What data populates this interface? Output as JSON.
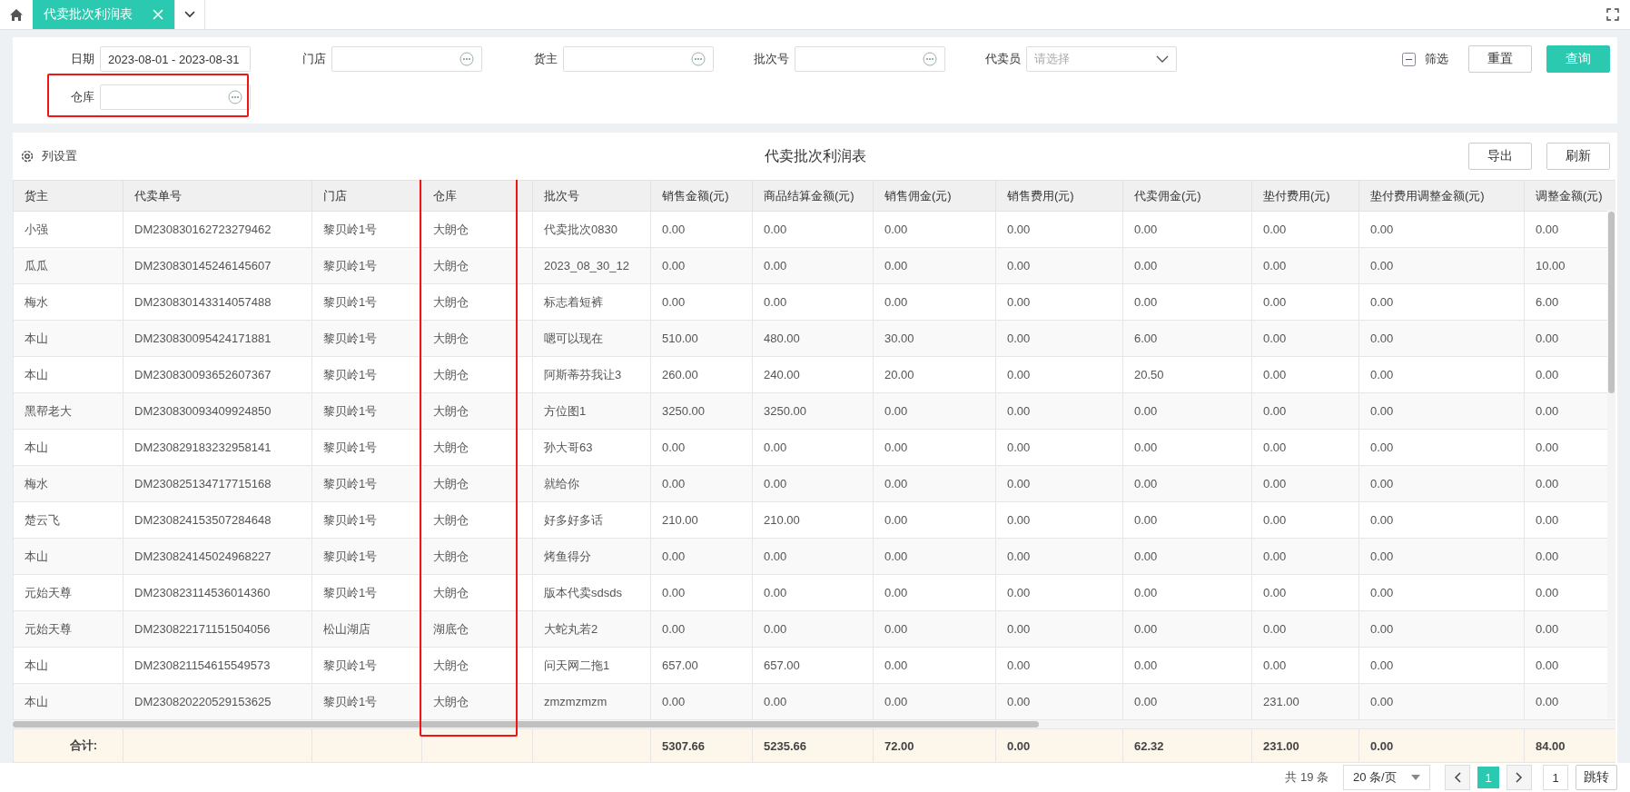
{
  "tabs": [
    {
      "label": "代卖批次利润表",
      "selected": true
    }
  ],
  "filters": [
    {
      "label": "日期",
      "kind": "text",
      "value": "2023-08-01 - 2023-08-31",
      "highlighted": false
    },
    {
      "label": "门店",
      "kind": "picker",
      "highlighted": false
    },
    {
      "label": "货主",
      "kind": "picker",
      "highlighted": false
    },
    {
      "label": "批次号",
      "kind": "picker",
      "highlighted": false
    },
    {
      "label": "代卖员",
      "kind": "select",
      "placeholder": "请选择",
      "highlighted": false
    },
    {
      "label": "仓库",
      "kind": "picker",
      "highlighted": true
    }
  ],
  "filter_toggle": {
    "label": "筛选"
  },
  "filter_buttons": [
    {
      "label": "重置",
      "kind": "secondary"
    },
    {
      "label": "查询",
      "kind": "primary"
    }
  ],
  "table_toolbar": {
    "settings_label": "列设置",
    "title": "代卖批次利润表",
    "buttons": [
      "导出",
      "刷新"
    ]
  },
  "table": {
    "columns": [
      {
        "label": "货主",
        "highlighted": false
      },
      {
        "label": "代卖单号",
        "highlighted": false
      },
      {
        "label": "门店",
        "highlighted": false
      },
      {
        "label": "仓库",
        "highlighted": true
      },
      {
        "label": "批次号",
        "highlighted": false
      },
      {
        "label": "销售金额(元)",
        "highlighted": false
      },
      {
        "label": "商品结算金额(元)",
        "highlighted": false
      },
      {
        "label": "销售佣金(元)",
        "highlighted": false
      },
      {
        "label": "销售费用(元)",
        "highlighted": false
      },
      {
        "label": "代卖佣金(元)",
        "highlighted": false
      },
      {
        "label": "垫付费用(元)",
        "highlighted": false
      },
      {
        "label": "垫付费用调整金额(元)",
        "highlighted": false
      },
      {
        "label": "调整金额(元)",
        "highlighted": false
      }
    ],
    "rows": [
      [
        "小强",
        "DM230830162723279462",
        "黎贝岭1号",
        "大朗仓",
        "代卖批次0830",
        "0.00",
        "0.00",
        "0.00",
        "0.00",
        "0.00",
        "0.00",
        "0.00",
        "0.00"
      ],
      [
        "瓜瓜",
        "DM230830145246145607",
        "黎贝岭1号",
        "大朗仓",
        "2023_08_30_12",
        "0.00",
        "0.00",
        "0.00",
        "0.00",
        "0.00",
        "0.00",
        "0.00",
        "10.00"
      ],
      [
        "梅水",
        "DM230830143314057488",
        "黎贝岭1号",
        "大朗仓",
        "标志着短裤",
        "0.00",
        "0.00",
        "0.00",
        "0.00",
        "0.00",
        "0.00",
        "0.00",
        "6.00"
      ],
      [
        "本山",
        "DM230830095424171881",
        "黎贝岭1号",
        "大朗仓",
        "嗯可以现在",
        "510.00",
        "480.00",
        "30.00",
        "0.00",
        "6.00",
        "0.00",
        "0.00",
        "0.00"
      ],
      [
        "本山",
        "DM230830093652607367",
        "黎贝岭1号",
        "大朗仓",
        "阿斯蒂芬我让3",
        "260.00",
        "240.00",
        "20.00",
        "0.00",
        "20.50",
        "0.00",
        "0.00",
        "0.00"
      ],
      [
        "黑帮老大",
        "DM230830093409924850",
        "黎贝岭1号",
        "大朗仓",
        "方位图1",
        "3250.00",
        "3250.00",
        "0.00",
        "0.00",
        "0.00",
        "0.00",
        "0.00",
        "0.00"
      ],
      [
        "本山",
        "DM230829183232958141",
        "黎贝岭1号",
        "大朗仓",
        "孙大哥63",
        "0.00",
        "0.00",
        "0.00",
        "0.00",
        "0.00",
        "0.00",
        "0.00",
        "0.00"
      ],
      [
        "梅水",
        "DM230825134717715168",
        "黎贝岭1号",
        "大朗仓",
        "就给你",
        "0.00",
        "0.00",
        "0.00",
        "0.00",
        "0.00",
        "0.00",
        "0.00",
        "0.00"
      ],
      [
        "楚云飞",
        "DM230824153507284648",
        "黎贝岭1号",
        "大朗仓",
        "好多好多话",
        "210.00",
        "210.00",
        "0.00",
        "0.00",
        "0.00",
        "0.00",
        "0.00",
        "0.00"
      ],
      [
        "本山",
        "DM230824145024968227",
        "黎贝岭1号",
        "大朗仓",
        "烤鱼得分",
        "0.00",
        "0.00",
        "0.00",
        "0.00",
        "0.00",
        "0.00",
        "0.00",
        "0.00"
      ],
      [
        "元始天尊",
        "DM230823114536014360",
        "黎贝岭1号",
        "大朗仓",
        "版本代卖sdsds",
        "0.00",
        "0.00",
        "0.00",
        "0.00",
        "0.00",
        "0.00",
        "0.00",
        "0.00"
      ],
      [
        "元始天尊",
        "DM230822171151504056",
        "松山湖店",
        "湖底仓",
        "大蛇丸若2",
        "0.00",
        "0.00",
        "0.00",
        "0.00",
        "0.00",
        "0.00",
        "0.00",
        "0.00"
      ],
      [
        "本山",
        "DM230821154615549573",
        "黎贝岭1号",
        "大朗仓",
        "问天网二拖1",
        "657.00",
        "657.00",
        "0.00",
        "0.00",
        "0.00",
        "0.00",
        "0.00",
        "0.00"
      ],
      [
        "本山",
        "DM230820220529153625",
        "黎贝岭1号",
        "大朗仓",
        "zmzmzmzm",
        "0.00",
        "0.00",
        "0.00",
        "0.00",
        "0.00",
        "231.00",
        "0.00",
        "0.00"
      ]
    ],
    "totals": {
      "label": "合计:",
      "values": [
        "5307.66",
        "5235.66",
        "72.00",
        "0.00",
        "62.32",
        "231.00",
        "0.00",
        "84.00"
      ]
    }
  },
  "pagination": {
    "total": "共 19 条",
    "page_size": "20 条/页",
    "pages": [
      {
        "label": "1",
        "selected": true
      }
    ],
    "jump_value": "1",
    "jump_label": "跳转"
  }
}
